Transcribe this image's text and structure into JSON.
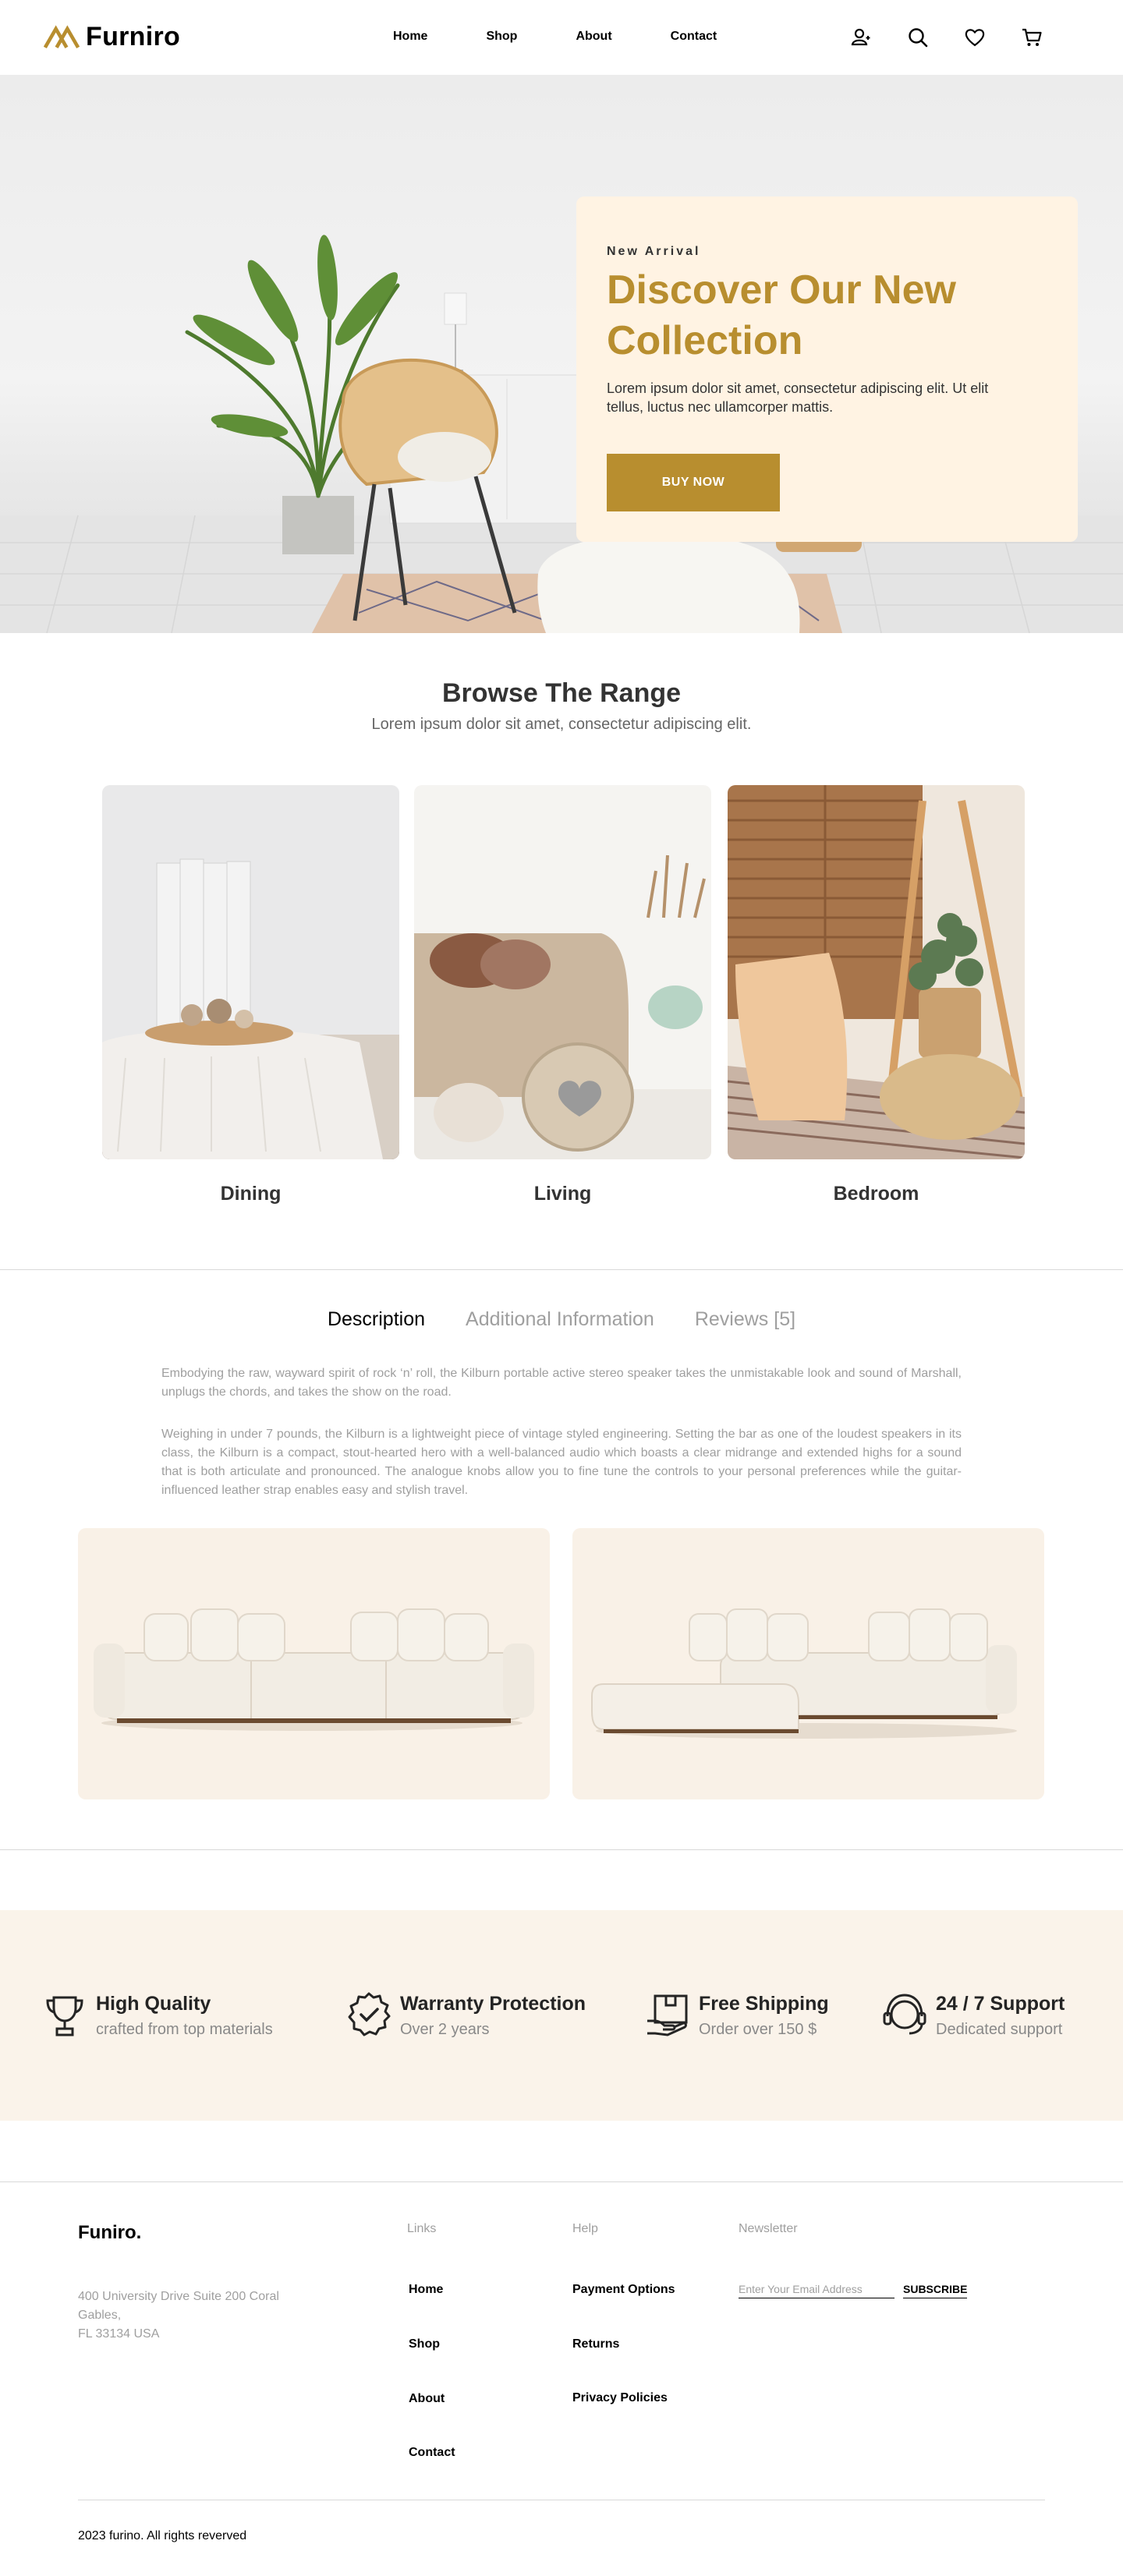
{
  "header": {
    "brand": "Furniro",
    "nav": [
      "Home",
      "Shop",
      "About",
      "Contact"
    ],
    "icons": [
      "user-icon",
      "search-icon",
      "heart-icon",
      "cart-icon"
    ]
  },
  "hero": {
    "kicker": "New Arrival",
    "title": "Discover Our New Collection",
    "description": "Lorem ipsum dolor sit amet, consectetur adipiscing elit. Ut elit tellus, luctus nec ullamcorper mattis.",
    "button": "BUY NOW"
  },
  "range": {
    "title": "Browse The Range",
    "subtitle": "Lorem ipsum dolor sit amet, consectetur adipiscing elit.",
    "items": [
      {
        "label": "Dining"
      },
      {
        "label": "Living"
      },
      {
        "label": "Bedroom"
      }
    ]
  },
  "tabs": {
    "items": [
      "Description",
      "Additional Information",
      "Reviews [5]"
    ],
    "active": "Description"
  },
  "description": {
    "p1": "Embodying the raw, wayward spirit of rock ‘n’ roll, the Kilburn portable active stereo speaker takes the unmistakable look and sound of Marshall, unplugs the chords, and takes the show on the road.",
    "p2": "Weighing in under 7 pounds, the Kilburn is a lightweight piece of vintage styled engineering. Setting the bar as one of the loudest speakers in its class, the Kilburn is a compact, stout-hearted hero with a well-balanced audio which boasts a clear midrange and extended highs for a sound that is both articulate and pronounced. The analogue knobs allow you to fine tune the controls to your personal preferences while the guitar-influenced leather strap enables easy and stylish travel."
  },
  "features": [
    {
      "title": "High Quality",
      "subtitle": "crafted from top materials",
      "icon": "trophy-icon"
    },
    {
      "title": "Warranty Protection",
      "subtitle": "Over 2 years",
      "icon": "guarantee-icon"
    },
    {
      "title": "Free Shipping",
      "subtitle": "Order over 150 $",
      "icon": "shipping-icon"
    },
    {
      "title": "24 / 7 Support",
      "subtitle": "Dedicated support",
      "icon": "customer-support-icon"
    }
  ],
  "footer": {
    "brand": "Funiro.",
    "address": [
      "400 University Drive Suite 200 Coral Gables,",
      "FL 33134 USA"
    ],
    "links_heading": "Links",
    "links": [
      "Home",
      "Shop",
      "About",
      "Contact"
    ],
    "help_heading": "Help",
    "help": [
      "Payment Options",
      "Returns",
      "Privacy Policies"
    ],
    "newsletter_heading": "Newsletter",
    "newsletter_placeholder": "Enter Your Email Address",
    "subscribe": "SUBSCRIBE",
    "copyright": "2023 furino. All rights reverved"
  },
  "colors": {
    "accent": "#b88e2f",
    "hero_card": "#fff3e3",
    "feature_bg": "#faf3ea",
    "sofa_bg": "#f9f1e7"
  }
}
